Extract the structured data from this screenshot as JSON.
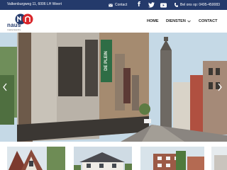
{
  "topbar": {
    "address": "Valkenburgweg 11, 6006 LH Weert",
    "contact_label": "Contact",
    "social": {
      "facebook": "f",
      "twitter": "twitter-icon",
      "youtube": "youtube-icon"
    },
    "phone": "Bel ons op: 0495-450083"
  },
  "brand": {
    "name": "naus",
    "subtitle": "makelaardij",
    "colors": {
      "navy": "#243a6b",
      "red": "#d9262a"
    }
  },
  "nav": {
    "items": [
      {
        "label": "HOME"
      },
      {
        "label": "DIENSTEN"
      },
      {
        "label": "CONTACT"
      }
    ]
  },
  "hero": {
    "shop_sign": "DE PLEIN"
  },
  "thumbnails": [
    {
      "icon": "house-photo"
    },
    {
      "icon": "villa-photo"
    },
    {
      "icon": "apartment-photo"
    },
    {
      "icon": "house-photo"
    }
  ]
}
